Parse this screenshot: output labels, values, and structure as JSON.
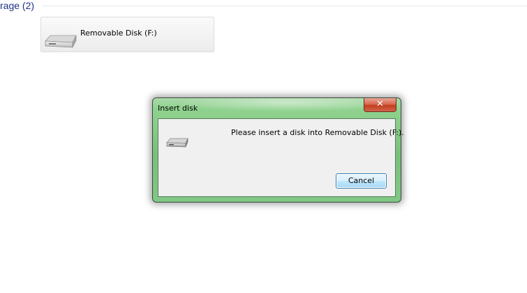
{
  "group": {
    "title": "rage (2)"
  },
  "drive_tile": {
    "label": "Removable Disk (F:)",
    "icon": "removable-drive-icon"
  },
  "dialog": {
    "title": "Insert disk",
    "close_glyph": "✕",
    "icon": "removable-drive-icon",
    "message": "Please insert a disk into Removable Disk (F:).",
    "cancel_label": "Cancel"
  },
  "colors": {
    "group_title": "#1e3287",
    "frame_green": "#86cb86",
    "close_red": "#c2401f",
    "button_blue": "#3c7fb1"
  }
}
